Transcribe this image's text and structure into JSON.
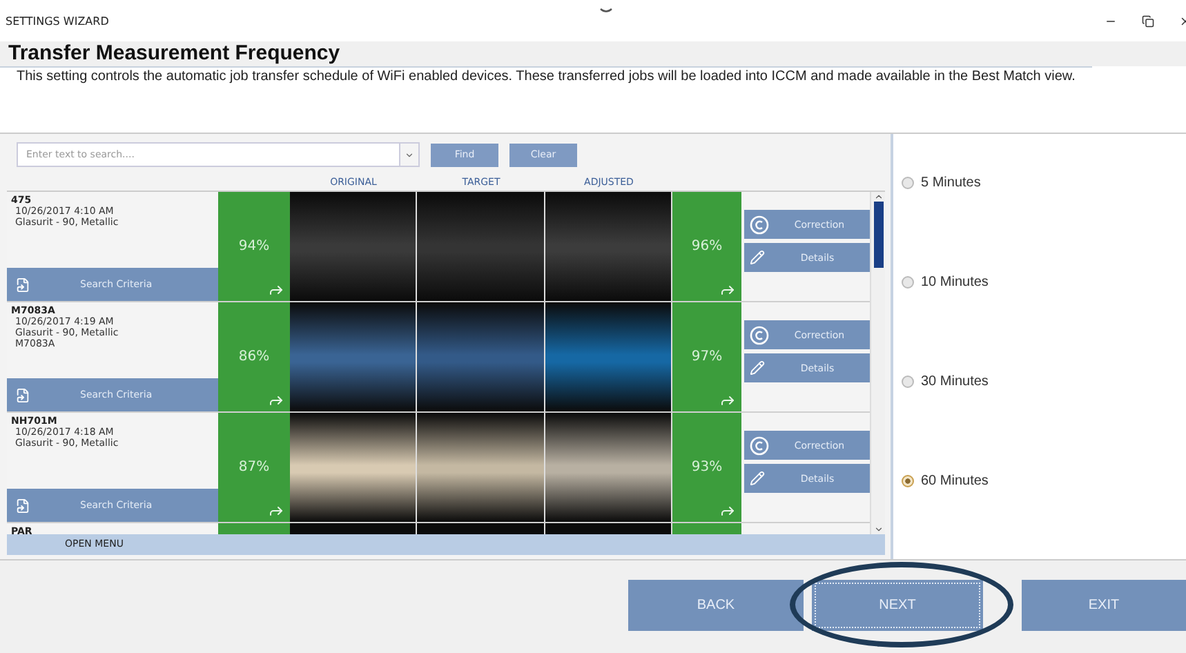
{
  "window": {
    "title": "SETTINGS WIZARD"
  },
  "page": {
    "heading": "Transfer Measurement Frequency",
    "description": "This setting controls the automatic job transfer schedule of WiFi enabled devices.  These transferred jobs will be loaded into ICCM and made available in the Best Match view."
  },
  "search": {
    "placeholder": "Enter text to search....",
    "buttons": [
      "Find",
      "Clear"
    ]
  },
  "columns": [
    "ORIGINAL",
    "TARGET",
    "ADJUSTED"
  ],
  "jobs": [
    {
      "name": "475",
      "lines": [
        "10/26/2017 4:10 AM",
        "Glasurit - 90, Metallic"
      ],
      "criteria": "Search Criteria",
      "original_match": "94%",
      "adjusted_match": "96%",
      "actions": [
        "Correction",
        "Details"
      ],
      "swatches": [
        {
          "color": "#3a3a3a"
        },
        {
          "color": "#343434"
        },
        {
          "color": "#3c3c3c"
        }
      ]
    },
    {
      "name": "M7083A",
      "lines": [
        "10/26/2017 4:19 AM",
        "Glasurit - 90, Metallic",
        "M7083A"
      ],
      "criteria": "Search Criteria",
      "original_match": "86%",
      "adjusted_match": "97%",
      "actions": [
        "Correction",
        "Details"
      ],
      "swatches": [
        {
          "color": "#3a6494"
        },
        {
          "color": "#335a88"
        },
        {
          "color": "#1668a4"
        }
      ]
    },
    {
      "name": "NH701M",
      "lines": [
        "10/26/2017 4:18 AM",
        "Glasurit - 90, Metallic"
      ],
      "criteria": "Search Criteria",
      "original_match": "87%",
      "adjusted_match": "93%",
      "actions": [
        "Correction",
        "Details"
      ],
      "swatches": [
        {
          "color": "#d8cab2"
        },
        {
          "color": "#c4b8a2"
        },
        {
          "color": "#b8b0a2"
        }
      ]
    },
    {
      "name": "PAR",
      "swatches": [
        {
          "color": "#0b0b0b"
        },
        {
          "color": "#0b0b0b"
        },
        {
          "color": "#0b0b0b"
        }
      ]
    }
  ],
  "list_footer": "OPEN MENU",
  "options": [
    {
      "label": "5 Minutes",
      "selected": false
    },
    {
      "label": "10 Minutes",
      "selected": false
    },
    {
      "label": "30 Minutes",
      "selected": false
    },
    {
      "label": "60 Minutes",
      "selected": true
    }
  ],
  "buttons": [
    {
      "label": "BACK",
      "focused": false,
      "highlighted": false
    },
    {
      "label": "NEXT",
      "focused": true,
      "highlighted": true
    },
    {
      "label": "EXIT",
      "focused": false,
      "highlighted": false
    }
  ]
}
